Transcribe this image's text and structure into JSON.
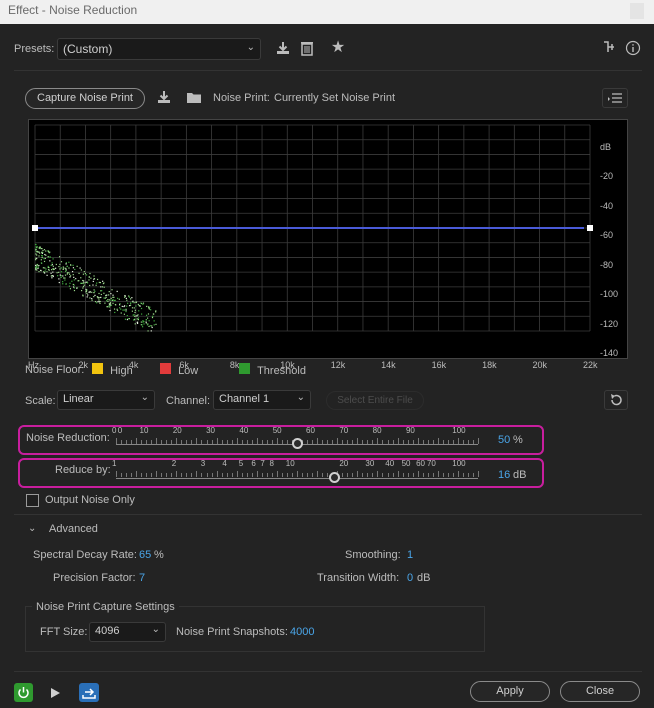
{
  "window": {
    "title": "Effect - Noise Reduction"
  },
  "presets": {
    "label": "Presets:",
    "value": "(Custom)"
  },
  "icons": {
    "save_preset": "save-preset-icon",
    "delete_preset": "delete-icon",
    "favorite": "star-icon",
    "routing": "routing-icon",
    "help": "help-icon"
  },
  "noise_print": {
    "capture_label": "Capture Noise Print",
    "status_label": "Noise Print:",
    "status_value": "Currently Set Noise Print"
  },
  "graph": {
    "y_ticks": [
      "dB",
      "-20",
      "-40",
      "-60",
      "-80",
      "-100",
      "-120",
      "-140"
    ],
    "x_ticks": [
      "Hz",
      "2k",
      "4k",
      "6k",
      "8k",
      "10k",
      "12k",
      "14k",
      "16k",
      "18k",
      "20k",
      "22k"
    ],
    "threshold_color": "#4a5bd8",
    "threshold_db": -70
  },
  "legend": {
    "title": "Noise Floor:",
    "items": [
      {
        "label": "High",
        "color": "#f2c40f"
      },
      {
        "label": "Low",
        "color": "#e23b3b"
      },
      {
        "label": "Threshold",
        "color": "#2f9a2f"
      }
    ]
  },
  "scale": {
    "label": "Scale:",
    "value": "Linear"
  },
  "channel": {
    "label": "Channel:",
    "value": "Channel 1"
  },
  "select_entire_file": "Select Entire File",
  "noise_reduction": {
    "label": "Noise Reduction:",
    "ticks": [
      "0",
      "0",
      "10",
      "20",
      "30",
      "40",
      "50",
      "60",
      "70",
      "80",
      "90",
      "100"
    ],
    "value": "50",
    "unit": "%",
    "fraction": 0.5
  },
  "reduce_by": {
    "label": "Reduce by:",
    "ticks": [
      "1",
      "2",
      "3",
      "4",
      "5",
      "6",
      "7",
      "8",
      "10",
      "20",
      "30",
      "40",
      "50",
      "60",
      "70",
      "100"
    ],
    "value": "16",
    "unit": "dB"
  },
  "output_noise_only": {
    "label": "Output Noise Only",
    "checked": false
  },
  "advanced": {
    "label": "Advanced",
    "spectral_decay_rate": {
      "label": "Spectral Decay Rate:",
      "value": "65",
      "unit": "%"
    },
    "smoothing": {
      "label": "Smoothing:",
      "value": "1"
    },
    "precision_factor": {
      "label": "Precision Factor:",
      "value": "7"
    },
    "transition_width": {
      "label": "Transition Width:",
      "value": "0",
      "unit": "dB"
    }
  },
  "capture_settings": {
    "title": "Noise Print Capture Settings",
    "fft_label": "FFT Size:",
    "fft_value": "4096",
    "snapshots_label": "Noise Print Snapshots:",
    "snapshots_value": "4000"
  },
  "footer": {
    "apply": "Apply",
    "close": "Close"
  },
  "accent": "#4aa5e8",
  "highlight": "#c81e9e"
}
